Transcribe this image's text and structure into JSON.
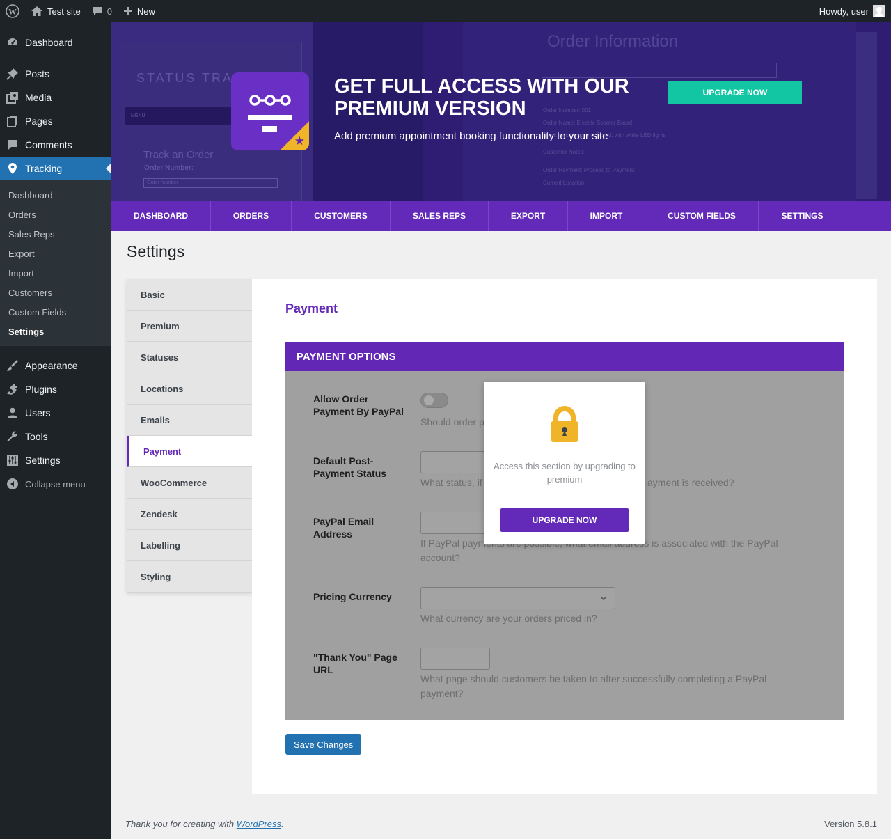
{
  "adminbar": {
    "site_name": "Test site",
    "comments_count": "0",
    "new_label": "New",
    "howdy": "Howdy, user"
  },
  "sidebar": {
    "items": [
      {
        "label": "Dashboard",
        "icon": "dashboard-icon"
      },
      {
        "label": "Posts",
        "icon": "pushpin-icon"
      },
      {
        "label": "Media",
        "icon": "media-icon"
      },
      {
        "label": "Pages",
        "icon": "pages-icon"
      },
      {
        "label": "Comments",
        "icon": "comment-icon"
      },
      {
        "label": "Tracking",
        "icon": "location-pin-icon"
      }
    ],
    "submenu": [
      "Dashboard",
      "Orders",
      "Sales Reps",
      "Export",
      "Import",
      "Customers",
      "Custom Fields",
      "Settings"
    ],
    "items_after": [
      {
        "label": "Appearance",
        "icon": "brush-icon"
      },
      {
        "label": "Plugins",
        "icon": "plugin-icon"
      },
      {
        "label": "Users",
        "icon": "user-icon"
      },
      {
        "label": "Tools",
        "icon": "wrench-icon"
      },
      {
        "label": "Settings",
        "icon": "sliders-icon"
      }
    ],
    "collapse_label": "Collapse menu"
  },
  "banner": {
    "title": "GET FULL ACCESS WITH OUR PREMIUM VERSION",
    "subtitle": "Add premium appointment booking functionality to your site",
    "upgrade_label": "UPGRADE NOW",
    "bg_status_text": "STATUS TRA",
    "bg_menu_text": "MENU",
    "bg_track_text": "Track an Order",
    "bg_order_number": "Order Number:",
    "bg_order_placeholder": "Order Number",
    "bg_order_info": "Order Information",
    "bg_rows": [
      "Order Number:   001",
      "Order Name:   Electric Scooter Board",
      "Black electric scooter board, with white LED lights",
      "Customer Notes:",
      "Order Payment:   Proceed to Payment",
      "Current Location:"
    ]
  },
  "nav": [
    "DASHBOARD",
    "ORDERS",
    "CUSTOMERS",
    "SALES REPS",
    "EXPORT",
    "IMPORT",
    "CUSTOM FIELDS",
    "SETTINGS"
  ],
  "page_title": "Settings",
  "settings_tabs": [
    "Basic",
    "Premium",
    "Statuses",
    "Locations",
    "Emails",
    "Payment",
    "WooCommerce",
    "Zendesk",
    "Labelling",
    "Styling"
  ],
  "panel": {
    "heading": "Payment",
    "section_title": "PAYMENT OPTIONS",
    "fields": [
      {
        "label": "Allow Order Payment By PayPal",
        "desc": "Should order p"
      },
      {
        "label": "Default Post-Payment Status",
        "desc_left": "What status, if",
        "desc_right": "ayment is received?"
      },
      {
        "label": "PayPal Email Address",
        "desc": "If PayPal payments are possible, what email address is associated with the PayPal account?"
      },
      {
        "label": "Pricing Currency",
        "desc": "What currency are your orders priced in?"
      },
      {
        "label": "\"Thank You\" Page URL",
        "desc": "What page should customers be taken to after successfully completing a PayPal payment?"
      }
    ],
    "lock_text": "Access this section by upgrading to premium",
    "lock_button": "UPGRADE NOW",
    "save_label": "Save Changes"
  },
  "footer": {
    "thanks_prefix": "Thank you for creating with ",
    "thanks_link": "WordPress",
    "thanks_suffix": ".",
    "version": "Version 5.8.1"
  },
  "colors": {
    "accent_purple": "#6329b8",
    "upgrade_teal": "#13c6a3",
    "wp_blue": "#2271b1",
    "lock_yellow": "#f0b429"
  }
}
